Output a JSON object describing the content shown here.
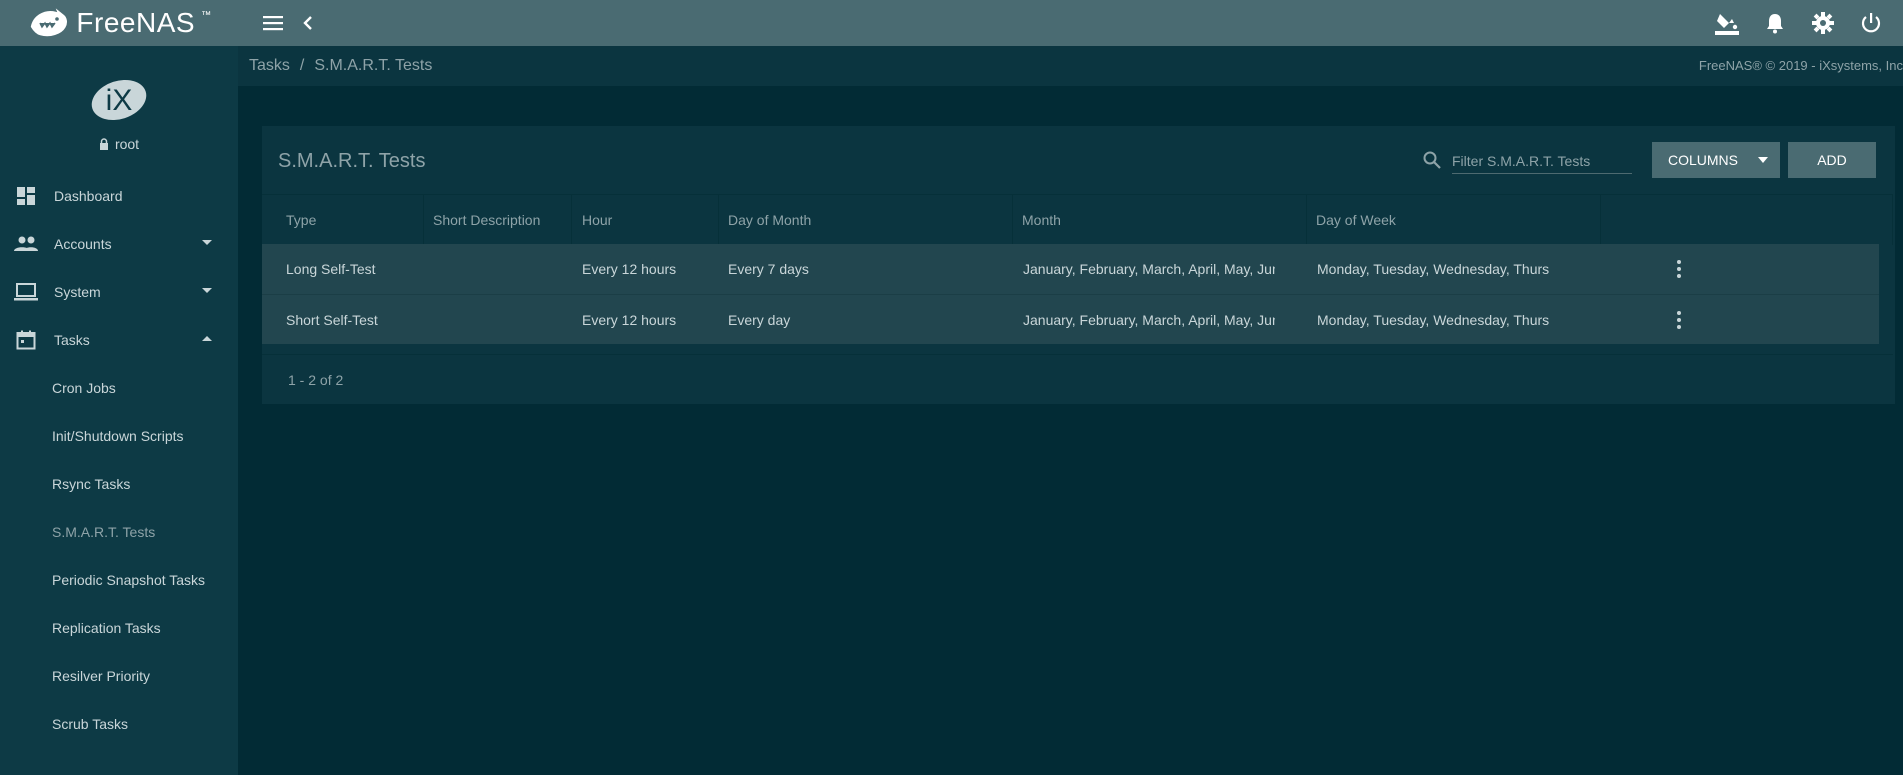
{
  "app": {
    "name": "FreeNAS",
    "trademark": "™"
  },
  "topbar": {
    "icons": [
      "menu-icon",
      "chevron-left-icon",
      "theme-paint-icon",
      "bell-icon",
      "gear-icon",
      "power-icon"
    ]
  },
  "user": {
    "name": "root",
    "logo": "iX"
  },
  "sidebar": {
    "items": [
      {
        "label": "Dashboard",
        "icon": "dashboard-icon"
      },
      {
        "label": "Accounts",
        "icon": "people-icon"
      },
      {
        "label": "System",
        "icon": "laptop-icon"
      },
      {
        "label": "Tasks",
        "icon": "calendar-icon"
      }
    ],
    "tasks_sub": [
      {
        "label": "Cron Jobs"
      },
      {
        "label": "Init/Shutdown Scripts"
      },
      {
        "label": "Rsync Tasks"
      },
      {
        "label": "S.M.A.R.T. Tests"
      },
      {
        "label": "Periodic Snapshot Tasks"
      },
      {
        "label": "Replication Tasks"
      },
      {
        "label": "Resilver Priority"
      },
      {
        "label": "Scrub Tasks"
      }
    ]
  },
  "breadcrumb": {
    "parent": "Tasks",
    "separator": "/",
    "current": "S.M.A.R.T. Tests"
  },
  "copyright": "FreeNAS® © 2019 - iXsystems, Inc",
  "card": {
    "title": "S.M.A.R.T. Tests",
    "filter_placeholder": "Filter S.M.A.R.T. Tests",
    "columns_label": "COLUMNS",
    "add_label": "ADD"
  },
  "table": {
    "headers": [
      "Type",
      "Short Description",
      "Hour",
      "Day of Month",
      "Month",
      "Day of Week"
    ],
    "rows": [
      {
        "type": "Long Self-Test",
        "desc": "",
        "hour": "Every 12 hours",
        "dom": "Every 7 days",
        "month": "January, February, March, April, May, June",
        "dow": "Monday, Tuesday, Wednesday, Thursday"
      },
      {
        "type": "Short Self-Test",
        "desc": "",
        "hour": "Every 12 hours",
        "dom": "Every day",
        "month": "January, February, March, April, May, June",
        "dow": "Monday, Tuesday, Wednesday, Thursday"
      }
    ],
    "pager": "1 - 2 of 2"
  },
  "colors": {
    "topbar": "#4a6b72",
    "sidebar": "#0d3a45",
    "background": "#022b35",
    "row": "#22464f"
  }
}
